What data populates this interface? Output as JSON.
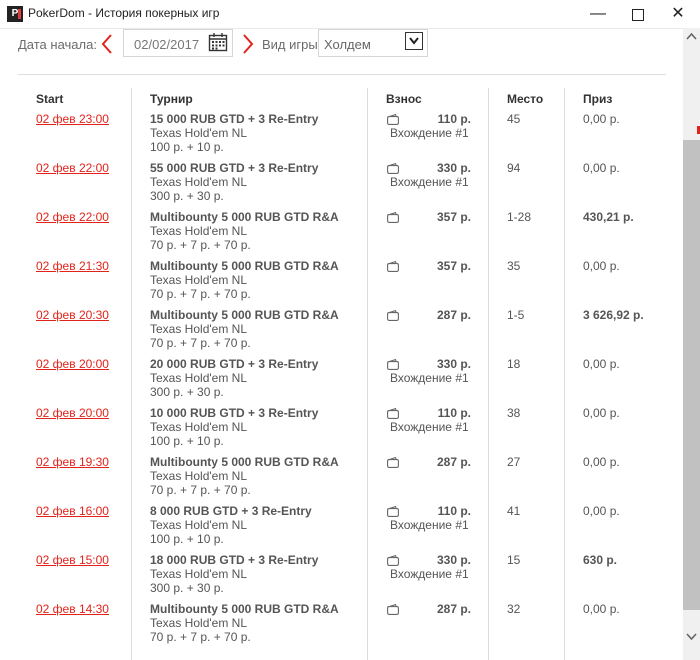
{
  "window": {
    "title": "PokerDom - История покерных игр",
    "logo_text": "P"
  },
  "filter": {
    "date_label": "Дата начала:",
    "date_value": "02/02/2017",
    "game_label": "Вид игры:",
    "game_value": "Холдем"
  },
  "table": {
    "headers": {
      "start": "Start",
      "tournament": "Турнир",
      "buyin": "Взнос",
      "place": "Место",
      "prize": "Приз"
    },
    "rows": [
      {
        "start": "02 фев 23:00",
        "name": "15 000 RUB GTD + 3 Re-Entry",
        "game": "Texas Hold'em NL",
        "fee": "100 р. + 10 р.",
        "buyin": "110 р.",
        "entry": "Вхождение #1",
        "place": "45",
        "prize": "0,00 р.",
        "prize_bold": false
      },
      {
        "start": "02 фев 22:00",
        "name": "55 000 RUB GTD + 3 Re-Entry",
        "game": "Texas Hold'em NL",
        "fee": "300 р. + 30 р.",
        "buyin": "330 р.",
        "entry": "Вхождение #1",
        "place": "94",
        "prize": "0,00 р.",
        "prize_bold": false
      },
      {
        "start": "02 фев 22:00",
        "name": "Multibounty 5 000 RUB GTD R&A",
        "game": "Texas Hold'em NL",
        "fee": "70 р. + 7 р. + 70 р.",
        "buyin": "357 р.",
        "entry": "",
        "place": "1-28",
        "prize": "430,21 р.",
        "prize_bold": true
      },
      {
        "start": "02 фев 21:30",
        "name": "Multibounty 5 000 RUB GTD R&A",
        "game": "Texas Hold'em NL",
        "fee": "70 р. + 7 р. + 70 р.",
        "buyin": "357 р.",
        "entry": "",
        "place": "35",
        "prize": "0,00 р.",
        "prize_bold": false
      },
      {
        "start": "02 фев 20:30",
        "name": "Multibounty 5 000 RUB GTD R&A",
        "game": "Texas Hold'em NL",
        "fee": "70 р. + 7 р. + 70 р.",
        "buyin": "287 р.",
        "entry": "",
        "place": "1-5",
        "prize": "3 626,92 р.",
        "prize_bold": true
      },
      {
        "start": "02 фев 20:00",
        "name": "20 000 RUB GTD + 3 Re-Entry",
        "game": "Texas Hold'em NL",
        "fee": "300 р. + 30 р.",
        "buyin": "330 р.",
        "entry": "Вхождение #1",
        "place": "18",
        "prize": "0,00 р.",
        "prize_bold": false
      },
      {
        "start": "02 фев 20:00",
        "name": "10 000 RUB GTD + 3 Re-Entry",
        "game": "Texas Hold'em NL",
        "fee": "100 р. + 10 р.",
        "buyin": "110 р.",
        "entry": "Вхождение #1",
        "place": "38",
        "prize": "0,00 р.",
        "prize_bold": false
      },
      {
        "start": "02 фев 19:30",
        "name": "Multibounty 5 000 RUB GTD R&A",
        "game": "Texas Hold'em NL",
        "fee": "70 р. + 7 р. + 70 р.",
        "buyin": "287 р.",
        "entry": "",
        "place": "27",
        "prize": "0,00 р.",
        "prize_bold": false
      },
      {
        "start": "02 фев 16:00",
        "name": "8 000 RUB GTD + 3 Re-Entry",
        "game": "Texas Hold'em NL",
        "fee": "100 р. + 10 р.",
        "buyin": "110 р.",
        "entry": "Вхождение #1",
        "place": "41",
        "prize": "0,00 р.",
        "prize_bold": false
      },
      {
        "start": "02 фев 15:00",
        "name": "18 000 RUB GTD + 3 Re-Entry",
        "game": "Texas Hold'em NL",
        "fee": "300 р. + 30 р.",
        "buyin": "330 р.",
        "entry": "Вхождение #1",
        "place": "15",
        "prize": "630 р.",
        "prize_bold": true
      },
      {
        "start": "02 фев 14:30",
        "name": "Multibounty 5 000 RUB GTD R&A",
        "game": "Texas Hold'em NL",
        "fee": "70 р. + 7 р. + 70 р.",
        "buyin": "287 р.",
        "entry": "",
        "place": "32",
        "prize": "0,00 р.",
        "prize_bold": false
      }
    ]
  },
  "icons": {
    "logo": "pokerdom-logo-icon",
    "minimize": "minimize-icon",
    "maximize": "maximize-icon",
    "close": "close-icon",
    "prev": "chevron-left-icon",
    "next": "chevron-right-icon",
    "calendar": "calendar-icon",
    "dropdown": "chevron-down-icon",
    "wallet": "wallet-icon"
  },
  "colors": {
    "accent": "#e2231a",
    "text": "#555555",
    "header_text": "#333333",
    "divider": "#dcdcdc"
  }
}
